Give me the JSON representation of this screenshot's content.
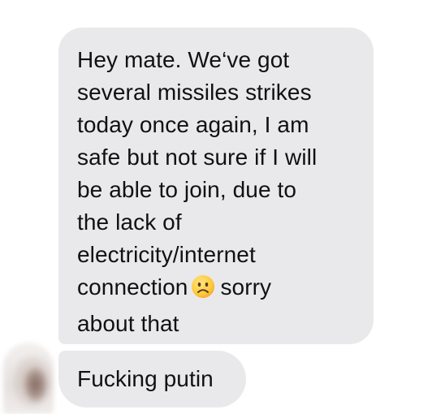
{
  "messages": [
    {
      "lines": [
        "Hey mate. We‘ve got",
        "several missiles strikes",
        "today once again, I am",
        "safe but not sure if I will",
        "be able to join, due to",
        "the lack of",
        "electricity/internet"
      ],
      "connection_text": "connection",
      "emoji": "frowning-face-emoji",
      "after_emoji_text": "sorry",
      "last_line": "about that"
    },
    {
      "text": "Fucking putin"
    }
  ],
  "colors": {
    "incoming_bubble": "#e9e9eb",
    "text": "#111111",
    "background": "#ffffff"
  }
}
